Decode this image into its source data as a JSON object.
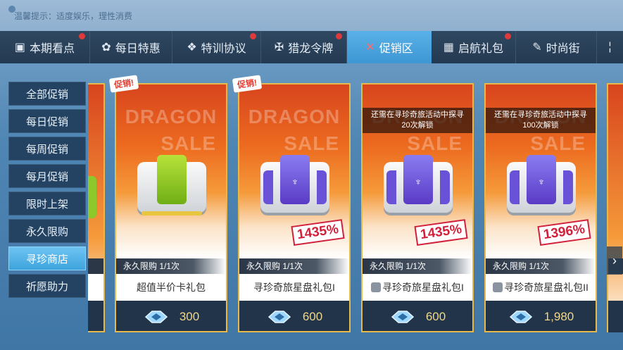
{
  "notice": "温馨提示：适度娱乐，理性消费",
  "tabs": [
    {
      "label": "本期看点",
      "icon": "gift-bag-icon",
      "dot": true
    },
    {
      "label": "每日特惠",
      "icon": "daily-icon",
      "dot": false
    },
    {
      "label": "特训协议",
      "icon": "wings-icon",
      "dot": true
    },
    {
      "label": "猎龙令牌",
      "icon": "dragon-badge-icon",
      "dot": true
    },
    {
      "label": "促销区",
      "icon": "promo-tag-icon",
      "dot": false,
      "active": true
    },
    {
      "label": "启航礼包",
      "icon": "giftbox-icon",
      "dot": true
    },
    {
      "label": "时尚街",
      "icon": "fashion-icon",
      "dot": false
    }
  ],
  "sidemenu": [
    "全部促销",
    "每日促销",
    "每周促销",
    "每月促销",
    "限时上架",
    "永久限购",
    "寻珍商店",
    "祈愿助力"
  ],
  "sidemenu_active_index": 6,
  "watermark": {
    "line1": "DRAGON",
    "line2": "SALE"
  },
  "cards": [
    {
      "sale_tag": "促销!",
      "lock_text": "",
      "discount": "",
      "limit": "永久限购 1/1次",
      "name": "超值半价卡礼包",
      "locked": false,
      "price": "300",
      "box": "green"
    },
    {
      "sale_tag": "促销!",
      "lock_text": "",
      "discount": "1435%",
      "limit": "永久限购 1/1次",
      "name": "寻珍奇旅星盘礼包I",
      "locked": false,
      "price": "600",
      "box": "purple"
    },
    {
      "sale_tag": "",
      "lock_text": "还需在寻珍奇旅活动中探寻20次解锁",
      "discount": "1435%",
      "limit": "永久限购 1/1次",
      "name": "寻珍奇旅星盘礼包I",
      "locked": true,
      "price": "600",
      "box": "purple"
    },
    {
      "sale_tag": "",
      "lock_text": "还需在寻珍奇旅活动中探寻100次解锁",
      "discount": "1396%",
      "limit": "永久限购 1/1次",
      "name": "寻珍奇旅星盘礼包II",
      "locked": true,
      "price": "1,980",
      "box": "purple"
    }
  ],
  "currency_icon": "diamond-gem-icon",
  "colors": {
    "card_border": "#e7b94a",
    "active_tab": "#3d97d3",
    "price_bg": "#223449",
    "discount_red": "#d2203a"
  }
}
